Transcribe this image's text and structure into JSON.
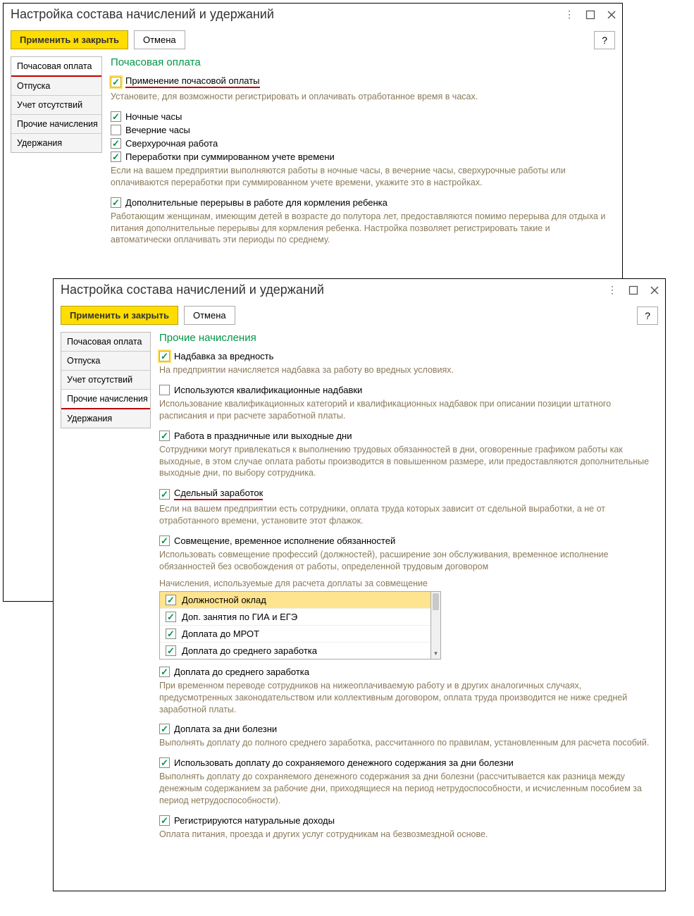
{
  "window1": {
    "title": "Настройка состава начислений и удержаний",
    "apply": "Применить и закрыть",
    "cancel": "Отмена",
    "help": "?",
    "nav": {
      "items": [
        {
          "label": "Почасовая оплата",
          "active": true,
          "ul": true
        },
        {
          "label": "Отпуска"
        },
        {
          "label": "Учет отсутствий"
        },
        {
          "label": "Прочие начисления"
        },
        {
          "label": "Удержания"
        }
      ]
    },
    "section_title": "Почасовая оплата",
    "chk_hourly": {
      "label": "Применение почасовой оплаты",
      "checked": true,
      "highlight": true,
      "ul": true
    },
    "desc_hourly": "Установите, для возможности регистрировать и оплачивать отработанное время в часах.",
    "chk_night": {
      "label": "Ночные часы",
      "checked": true
    },
    "chk_evening": {
      "label": "Вечерние часы",
      "checked": false
    },
    "chk_overtime": {
      "label": "Сверхурочная работа",
      "checked": true
    },
    "chk_sumover": {
      "label": "Переработки при суммированном учете времени",
      "checked": true
    },
    "desc_over": "Если на вашем предприятии выполняются работы в ночные часы, в вечерние часы, сверхурочные работы или оплачиваются переработки при суммированном учете времени, укажите это в настройках.",
    "chk_breaks": {
      "label": "Дополнительные перерывы в работе для кормления ребенка",
      "checked": true
    },
    "desc_breaks": "Работающим женщинам, имеющим детей в возрасте до полутора лет, предоставляются помимо перерыва для отдыха и питания дополнительные перерывы для кормления ребенка. Настройка позволяет регистрировать такие и автоматически оплачивать эти периоды по среднему."
  },
  "window2": {
    "title": "Настройка состава начислений и удержаний",
    "apply": "Применить и закрыть",
    "cancel": "Отмена",
    "help": "?",
    "nav": {
      "items": [
        {
          "label": "Почасовая оплата"
        },
        {
          "label": "Отпуска"
        },
        {
          "label": "Учет отсутствий"
        },
        {
          "label": "Прочие начисления",
          "active": true,
          "ul": true
        },
        {
          "label": "Удержания"
        }
      ]
    },
    "section_title": "Прочие начисления",
    "chk_hazard": {
      "label": "Надбавка за вредность",
      "checked": true,
      "highlight": true
    },
    "desc_hazard": "На предприятии начисляется надбавка за работу во вредных условиях.",
    "chk_qual": {
      "label": "Используются квалификационные надбавки",
      "checked": false
    },
    "desc_qual": "Использование квалификационных категорий и квалификационных надбавок при описании позиции штатного расписания и при расчете заработной платы.",
    "chk_holiday": {
      "label": "Работа в праздничные или выходные дни",
      "checked": true
    },
    "desc_holiday": "Сотрудники могут привлекаться к выполнению трудовых обязанностей в дни, оговоренные графиком работы как выходные, в этом случае оплата работы производится в повышенном размере, или предоставляются дополнительные выходные дни, по выбору сотрудника.",
    "chk_piece": {
      "label": "Сдельный заработок",
      "checked": true,
      "ul": true
    },
    "desc_piece": "Если на вашем предприятии есть сотрудники, оплата труда которых зависит от сдельной выработки, а не от отработанного времени, установите этот флажок.",
    "chk_combo": {
      "label": "Совмещение, временное исполнение обязанностей",
      "checked": true
    },
    "desc_combo": "Использовать совмещение профессий (должностей), расширение зон обслуживания, временное исполнение обязанностей без освобождения от работы, определенной трудовым договором",
    "list_title": "Начисления, используемые для расчета доплаты за совмещение",
    "list": [
      {
        "label": "Должностной оклад",
        "checked": true,
        "sel": true
      },
      {
        "label": "Доп. занятия по ГИА и ЕГЭ",
        "checked": true
      },
      {
        "label": "Доплата до МРОТ",
        "checked": true
      },
      {
        "label": "Доплата до среднего заработка",
        "checked": true
      }
    ],
    "chk_avg": {
      "label": "Доплата до среднего заработка",
      "checked": true
    },
    "desc_avg": "При временном переводе сотрудников на нижеоплачиваемую работу и в других аналогичных случаях, предусмотренных законодательством или коллективным договором, оплата труда производится не ниже средней заработной платы.",
    "chk_sick": {
      "label": "Доплата за дни болезни",
      "checked": true
    },
    "desc_sick": "Выполнять доплату до полного среднего заработка, рассчитанного по правилам, установленным для расчета пособий.",
    "chk_keep": {
      "label": "Использовать доплату до сохраняемого денежного содержания за дни болезни",
      "checked": true
    },
    "desc_keep": "Выполнять доплату до сохраняемого денежного содержания за дни болезни (рассчитывается как разница между денежным содержанием за рабочие дни, приходящиеся на период нетрудоспособности, и исчисленным пособием за период нетрудоспособности).",
    "chk_nat": {
      "label": "Регистрируются натуральные доходы",
      "checked": true
    },
    "desc_nat": "Оплата питания, проезда и других услуг сотрудникам на безвозмездной основе."
  }
}
